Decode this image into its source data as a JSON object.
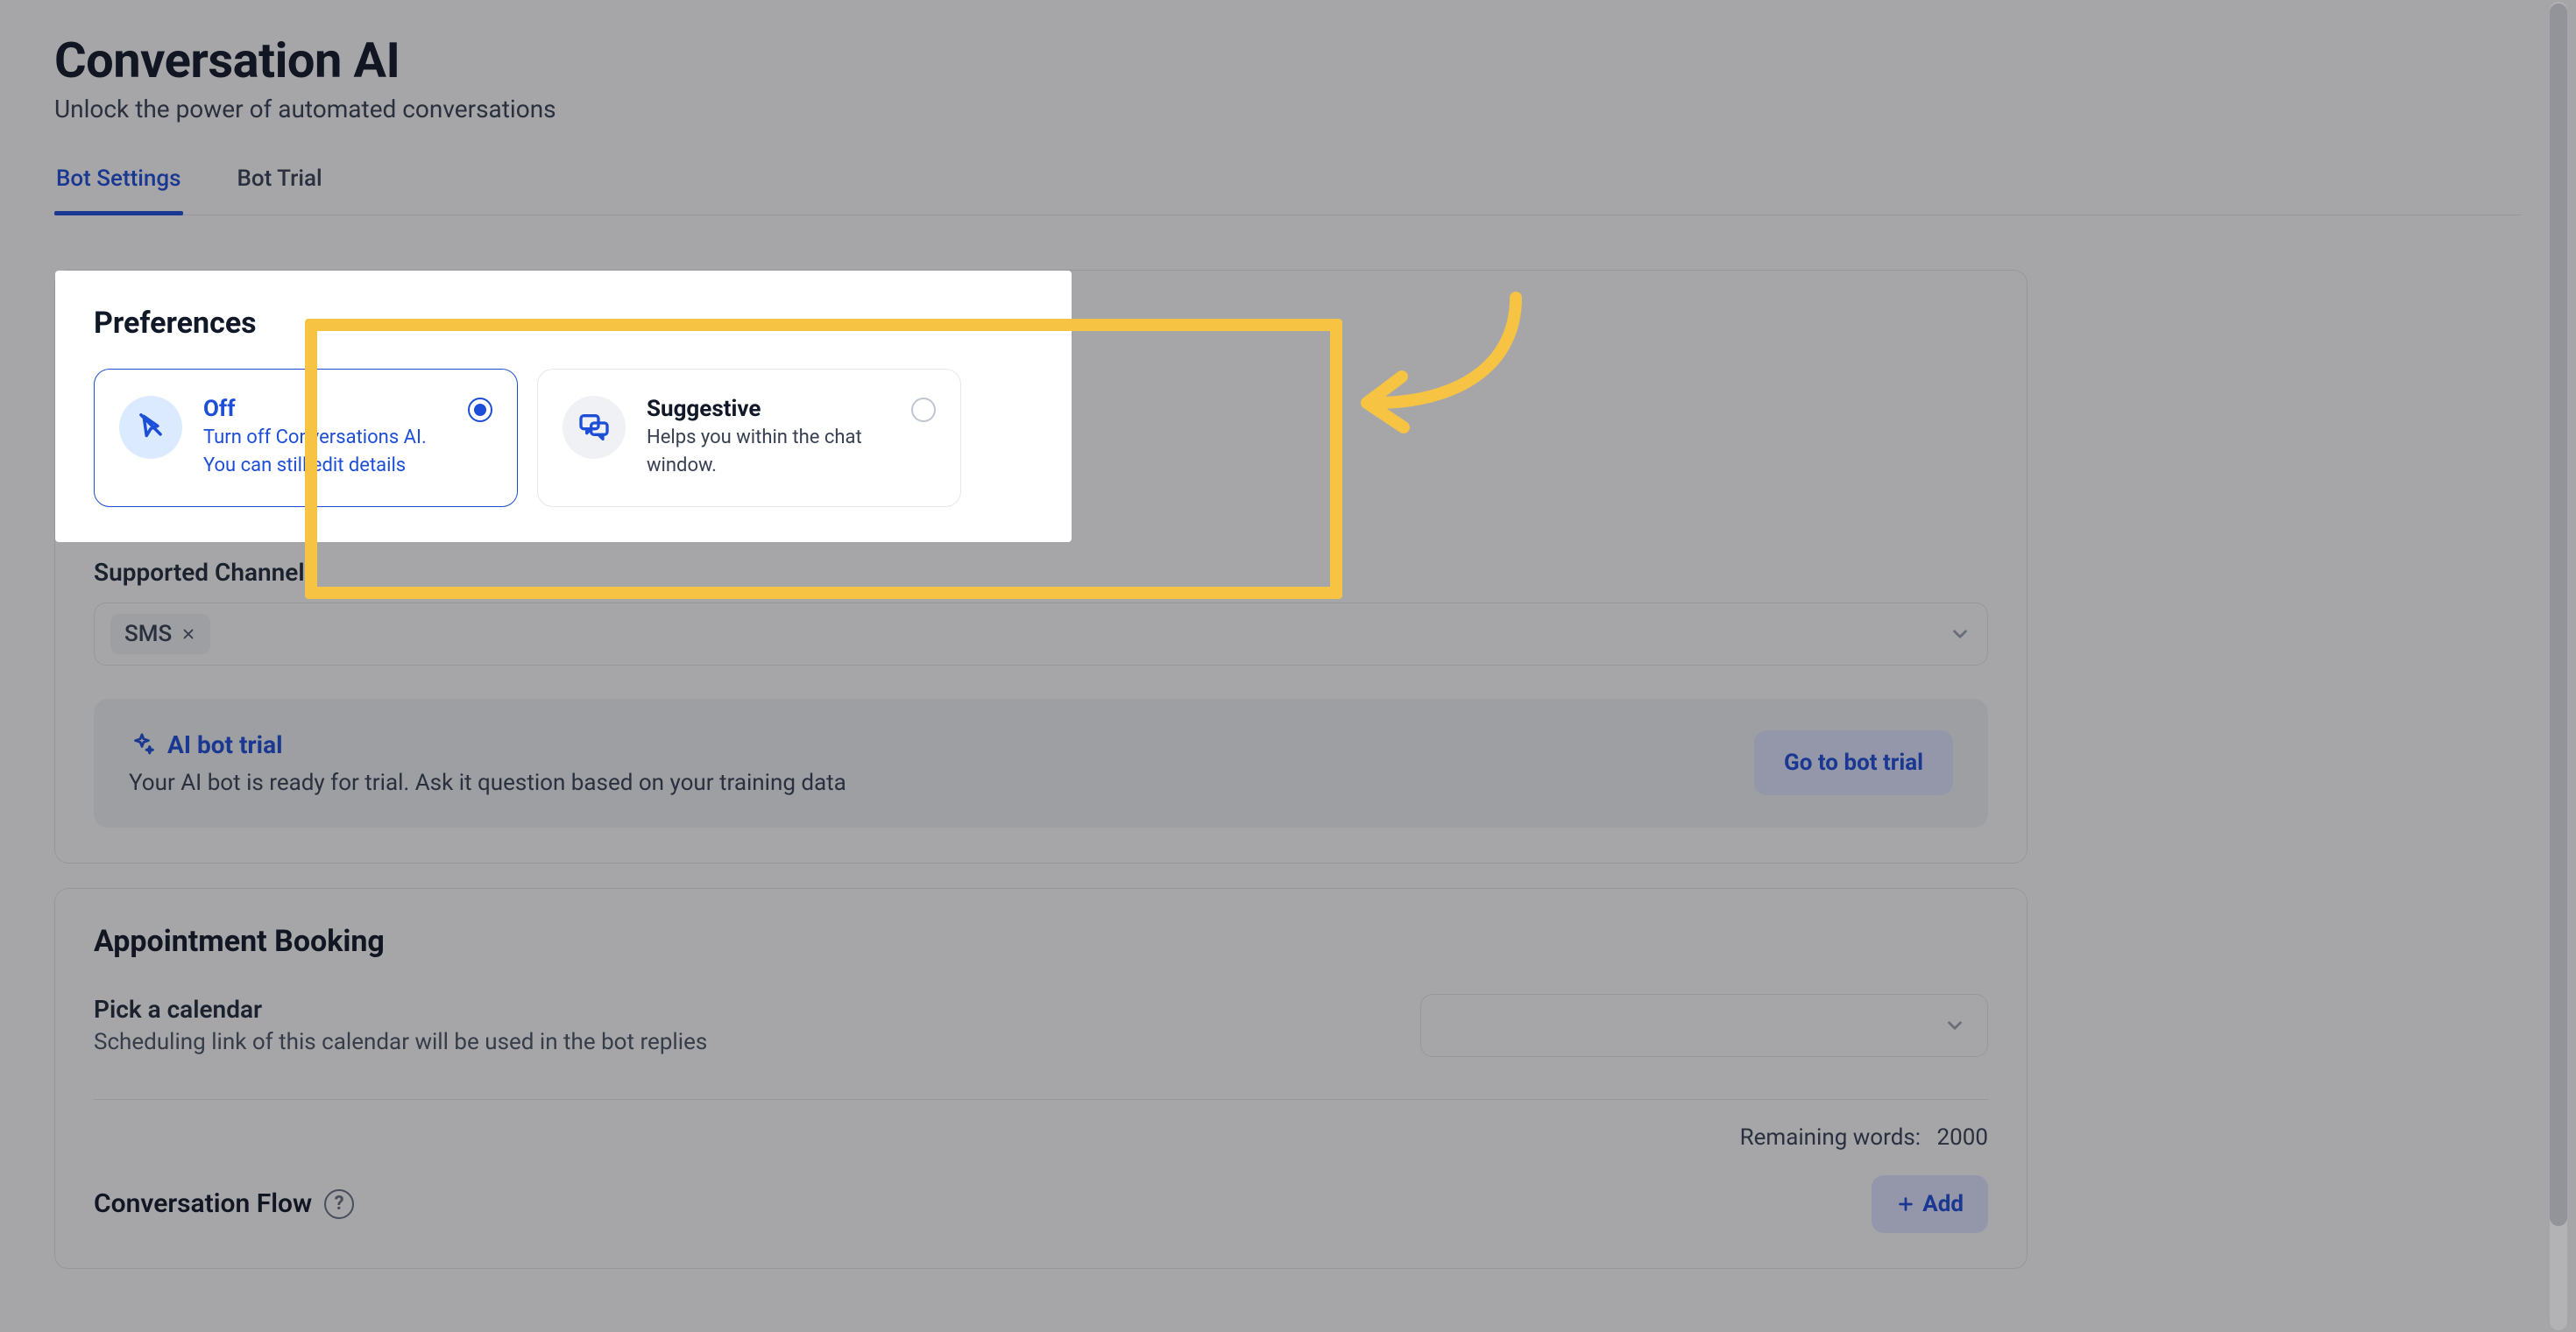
{
  "header": {
    "title": "Conversation AI",
    "subtitle": "Unlock the power of automated conversations"
  },
  "tabs": [
    {
      "label": "Bot Settings",
      "active": true
    },
    {
      "label": "Bot Trial",
      "active": false
    }
  ],
  "preferences": {
    "heading": "Preferences",
    "options": {
      "off": {
        "title": "Off",
        "line1": "Turn off Conversations AI.",
        "line2": "You can still edit details",
        "selected": true
      },
      "suggestive": {
        "title": "Suggestive",
        "line1": "Helps you within the chat window.",
        "selected": false
      }
    }
  },
  "channels": {
    "heading": "Supported Channels",
    "chip": "SMS"
  },
  "trial": {
    "title": "AI bot trial",
    "description": "Your AI bot is ready for trial. Ask it question based on your training data",
    "button": "Go to bot trial"
  },
  "appointment": {
    "heading": "Appointment Booking",
    "field_label": "Pick a calendar",
    "field_help": "Scheduling link of this calendar will be used in the bot replies",
    "remaining_label": "Remaining words:",
    "remaining_value": "2000"
  },
  "flow": {
    "title": "Conversation Flow",
    "add_button": "Add"
  }
}
